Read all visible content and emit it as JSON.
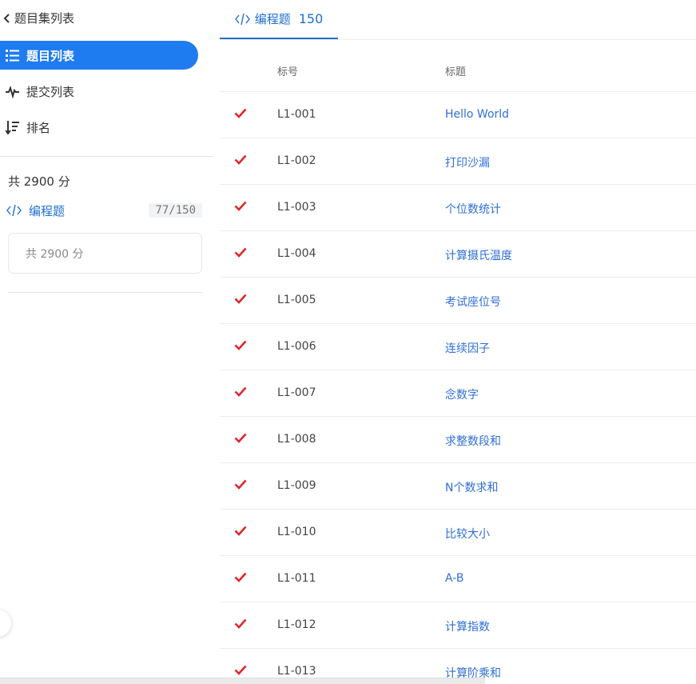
{
  "sidebar": {
    "back_label": "题目集列表",
    "nav": [
      {
        "label": "题目列表",
        "icon": "list-icon",
        "active": true
      },
      {
        "label": "提交列表",
        "icon": "activity-icon",
        "active": false
      },
      {
        "label": "排名",
        "icon": "sort-icon",
        "active": false
      }
    ],
    "total_score": "共 2900 分",
    "category": {
      "label": "编程题",
      "icon": "code-icon",
      "progress": "77/150"
    },
    "score_box": "共 2900 分"
  },
  "main": {
    "tab": {
      "label": "编程题",
      "count": "150",
      "icon": "code-icon"
    },
    "columns": {
      "num": "标号",
      "title": "标题"
    },
    "rows": [
      {
        "num": "L1-001",
        "title": "Hello World",
        "solved": true
      },
      {
        "num": "L1-002",
        "title": "打印沙漏",
        "solved": true
      },
      {
        "num": "L1-003",
        "title": "个位数统计",
        "solved": true
      },
      {
        "num": "L1-004",
        "title": "计算摄氏温度",
        "solved": true
      },
      {
        "num": "L1-005",
        "title": "考试座位号",
        "solved": true
      },
      {
        "num": "L1-006",
        "title": "连续因子",
        "solved": true
      },
      {
        "num": "L1-007",
        "title": "念数字",
        "solved": true
      },
      {
        "num": "L1-008",
        "title": "求整数段和",
        "solved": true
      },
      {
        "num": "L1-009",
        "title": "N个数求和",
        "solved": true
      },
      {
        "num": "L1-010",
        "title": "比较大小",
        "solved": true
      },
      {
        "num": "L1-011",
        "title": "A-B",
        "solved": true
      },
      {
        "num": "L1-012",
        "title": "计算指数",
        "solved": true
      },
      {
        "num": "L1-013",
        "title": "计算阶乘和",
        "solved": true
      }
    ]
  },
  "colors": {
    "accent": "#1f7cf0",
    "link": "#2f6fd6",
    "check": "#e0272c"
  }
}
